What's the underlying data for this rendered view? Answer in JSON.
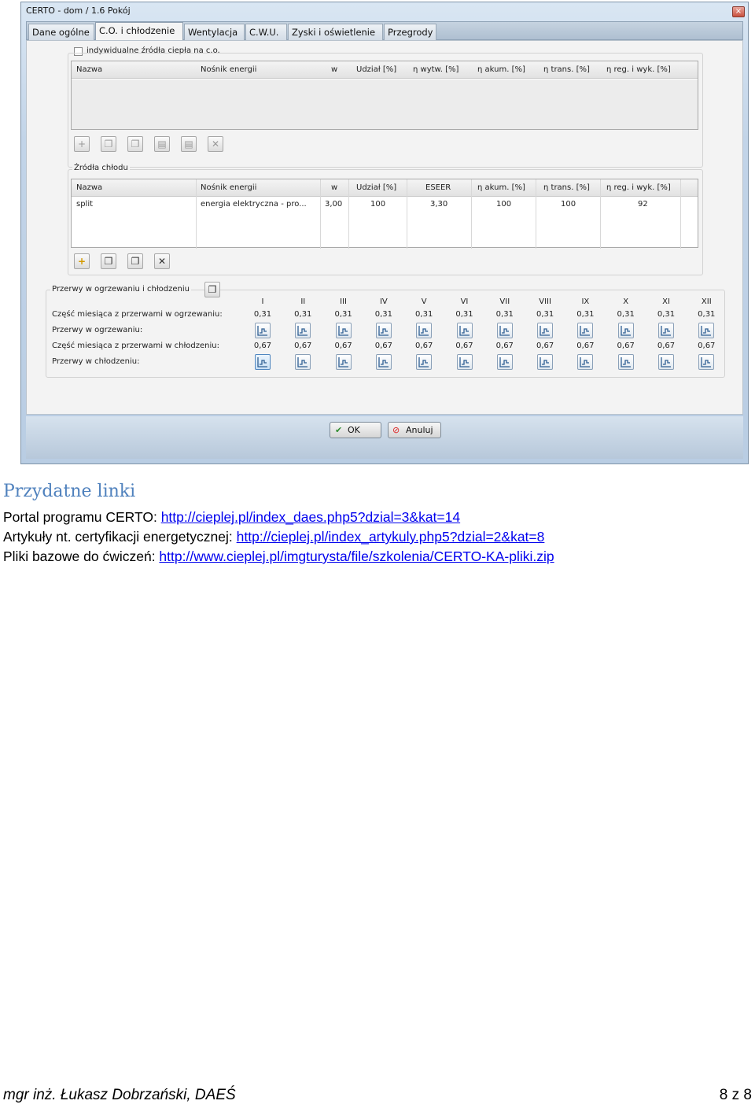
{
  "window": {
    "title": "CERTO - dom / 1.6 Pokój",
    "close_glyph": "×"
  },
  "tabs": [
    "Dane ogólne",
    "C.O. i chłodzenie",
    "Wentylacja",
    "C.W.U.",
    "Zyski i oświetlenie",
    "Przegrody"
  ],
  "active_tab": "C.O. i chłodzenie",
  "heating": {
    "checkbox_label": "indywidualne źródła ciepła na c.o.",
    "columns": [
      "Nazwa",
      "Nośnik energii",
      "w",
      "Udział [%]",
      "η wytw. [%]",
      "η akum. [%]",
      "η trans. [%]",
      "η reg. i wyk. [%]"
    ]
  },
  "cooling": {
    "legend": "Źródła chłodu",
    "columns": [
      "Nazwa",
      "Nośnik energii",
      "w",
      "Udział [%]",
      "ESEER",
      "η akum. [%]",
      "η trans. [%]",
      "η reg. i wyk. [%]"
    ],
    "rows": [
      [
        "split",
        "energia elektryczna - pro...",
        "3,00",
        "100",
        "3,30",
        "100",
        "100",
        "92"
      ]
    ]
  },
  "breaks": {
    "legend": "Przerwy w ogrzewaniu i chłodzeniu",
    "months": [
      "I",
      "II",
      "III",
      "IV",
      "V",
      "VI",
      "VII",
      "VIII",
      "IX",
      "X",
      "XI",
      "XII"
    ],
    "label_heating_fraction": "Część miesiąca z przerwami w ogrzewaniu:",
    "label_heating": "Przerwy w ogrzewaniu:",
    "label_cooling_fraction": "Część miesiąca z przerwami w chłodzeniu:",
    "label_cooling": "Przerwy w chłodzeniu:",
    "heating_values": [
      "0,31",
      "0,31",
      "0,31",
      "0,31",
      "0,31",
      "0,31",
      "0,31",
      "0,31",
      "0,31",
      "0,31",
      "0,31",
      "0,31"
    ],
    "cooling_values": [
      "0,67",
      "0,67",
      "0,67",
      "0,67",
      "0,67",
      "0,67",
      "0,67",
      "0,67",
      "0,67",
      "0,67",
      "0,67",
      "0,67"
    ]
  },
  "buttons": {
    "ok": "OK",
    "cancel": "Anuluj"
  },
  "links_section": {
    "heading": "Przydatne linki",
    "items": [
      {
        "label": "Portal programu CERTO: ",
        "url": "http://cieplej.pl/index_daes.php5?dzial=3&kat=14"
      },
      {
        "label": "Artykuły nt. certyfikacji energetycznej: ",
        "url": "http://cieplej.pl/index_artykuly.php5?dzial=2&kat=8"
      },
      {
        "label": "Pliki bazowe do ćwiczeń: ",
        "url": "http://www.cieplej.pl/imgturysta/file/szkolenia/CERTO-KA-pliki.zip"
      }
    ]
  },
  "footer": {
    "author": "mgr inż. Łukasz Dobrzański, DAEŚ",
    "page": "8 z 8"
  }
}
